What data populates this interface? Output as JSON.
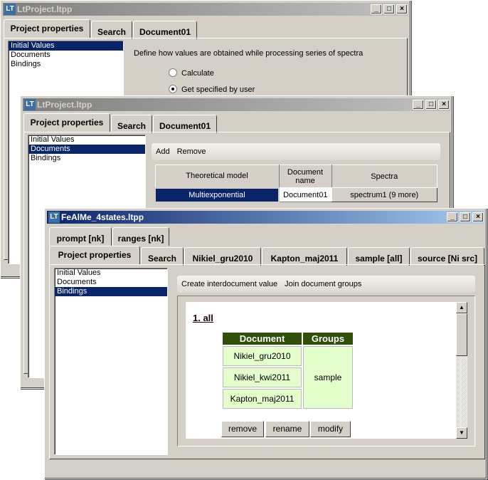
{
  "window1": {
    "title": "LtProject.ltpp",
    "tabs": [
      "Project properties",
      "Search",
      "Document01"
    ],
    "list": [
      "Initial Values",
      "Documents",
      "Bindings"
    ],
    "selected_list": "Initial Values",
    "description": "Define how values are obtained while processing series of spectra",
    "options": [
      {
        "label": "Calculate",
        "checked": false
      },
      {
        "label": "Get specified by user",
        "checked": true
      }
    ]
  },
  "window2": {
    "title": "LtProject.ltpp",
    "tabs": [
      "Project properties",
      "Search",
      "Document01"
    ],
    "list": [
      "Initial Values",
      "Documents",
      "Bindings"
    ],
    "selected_list": "Documents",
    "toolbar": [
      "Add",
      "Remove"
    ],
    "table": {
      "headers": [
        "Theoretical model",
        "Document name",
        "Spectra"
      ],
      "row": [
        "Multiexponential",
        "Document01",
        "spectrum1 (9 more)"
      ]
    }
  },
  "window3": {
    "title": "FeAlMe_4states.ltpp",
    "tabs_row1": [
      "prompt [nk]",
      "ranges [nk]"
    ],
    "tabs_row2": [
      "Project properties",
      "Search",
      "Nikiel_gru2010",
      "Kapton_maj2011",
      "sample [all]",
      "source [Ni src]"
    ],
    "list": [
      "Initial Values",
      "Documents",
      "Bindings"
    ],
    "selected_list": "Bindings",
    "toolbar": [
      "Create interdocument value",
      "Join document groups"
    ],
    "group_title": "1. all",
    "group_table": {
      "headers": [
        "Document",
        "Groups"
      ],
      "documents": [
        "Nikiel_gru2010",
        "Nikiel_kwi2011",
        "Kapton_maj2011"
      ],
      "group": "sample"
    },
    "buttons": [
      "remove",
      "rename",
      "modify"
    ],
    "colors": {
      "header": "#2f4f0a",
      "cell": "#e3fdcb",
      "selection": "#0a246a"
    }
  },
  "window_controls": {
    "minimize": "_",
    "maximize": "□",
    "close": "×"
  }
}
